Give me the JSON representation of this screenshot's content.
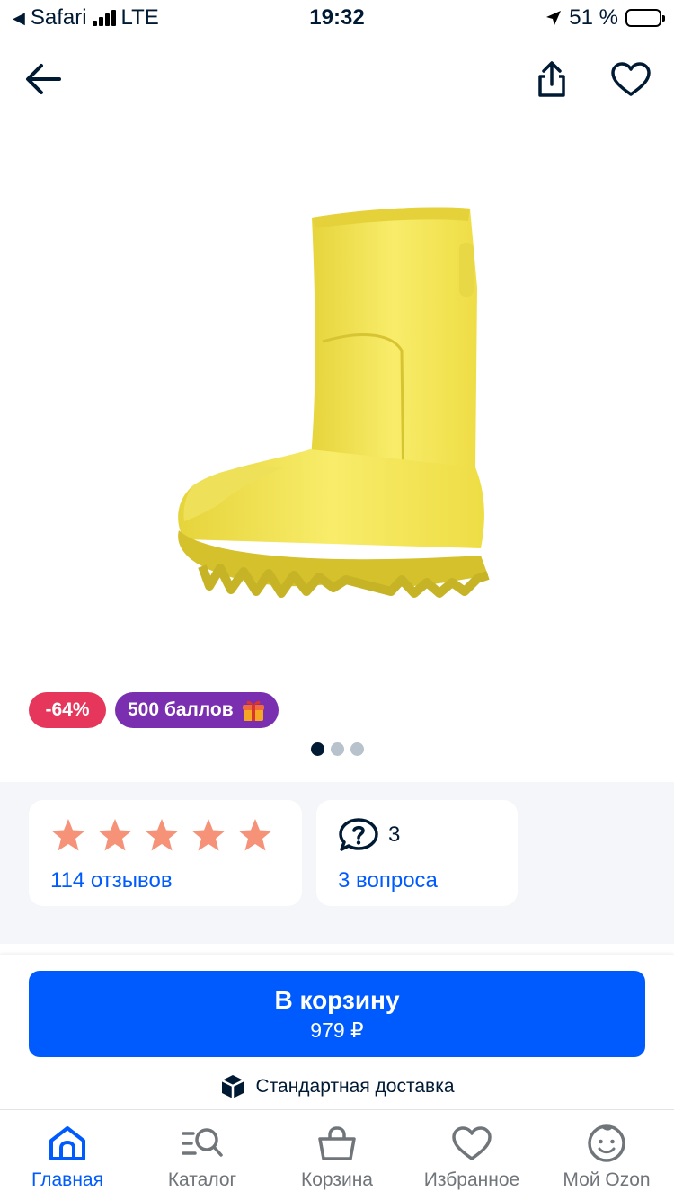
{
  "status_bar": {
    "back_app": "Safari",
    "network": "LTE",
    "time": "19:32",
    "battery": "51 %",
    "battery_level": 0.51
  },
  "top_bar": {
    "back_icon": "arrow-left-icon",
    "share_icon": "share-icon",
    "favorite_icon": "heart-icon"
  },
  "product": {
    "image_subject": "yellow rubber boot",
    "badges": {
      "discount": "-64%",
      "points": "500 баллов",
      "points_icon": "gift-icon"
    },
    "gallery": {
      "total": 3,
      "current": 1
    }
  },
  "reviews": {
    "rating": 5,
    "max": 5,
    "link": "114 отзывов",
    "star_color": "#f59278"
  },
  "questions": {
    "count": "3",
    "link": "3 вопроса",
    "icon": "question-bubble-icon"
  },
  "action": {
    "button_label": "В корзину",
    "price": "979 ₽",
    "delivery": "Стандартная доставка",
    "delivery_icon": "box-icon",
    "accent": "#005bff"
  },
  "tabs": [
    {
      "label": "Главная",
      "icon": "home-icon",
      "active": true
    },
    {
      "label": "Каталог",
      "icon": "catalog-search-icon",
      "active": false
    },
    {
      "label": "Корзина",
      "icon": "basket-icon",
      "active": false
    },
    {
      "label": "Избранное",
      "icon": "heart-icon",
      "active": false
    },
    {
      "label": "Мой Ozon",
      "icon": "profile-face-icon",
      "active": false
    }
  ]
}
